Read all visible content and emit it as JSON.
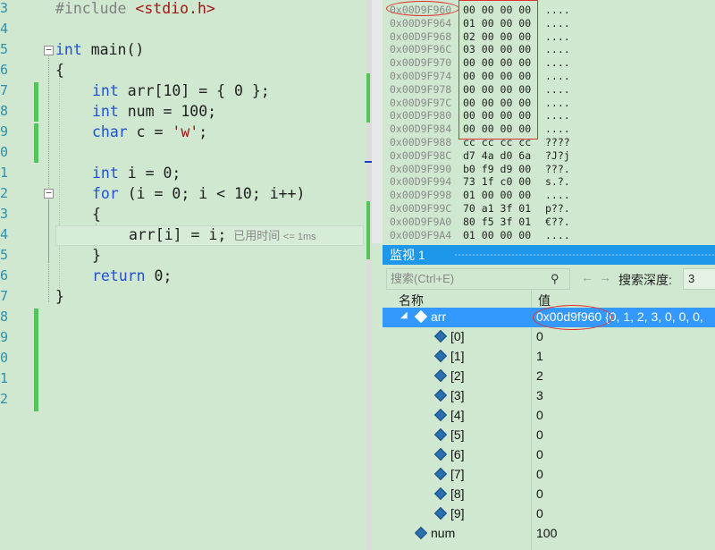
{
  "editor": {
    "line_numbers": [
      "3",
      "4",
      "5",
      "6",
      "7",
      "8",
      "9",
      "0",
      "1",
      "2",
      "3",
      "4",
      "5",
      "6",
      "7",
      "8",
      "9",
      "0",
      "1",
      "2"
    ],
    "include_kw": "#include",
    "include_hdr": "<stdio.h>",
    "main_sig_kw": "int",
    "main_sig": " main()",
    "open_brace": "{",
    "line_arr_kw": "int",
    "line_arr": " arr[10] = { 0 };",
    "line_num_kw": "int",
    "line_num": " num = 100;",
    "line_char_kw": "char",
    "line_char_a": " c = ",
    "line_char_str": "'w'",
    "line_char_b": ";",
    "line_i_kw": "int",
    "line_i": " i = 0;",
    "line_for_kw": "for",
    "line_for": " (i = 0; i < 10; i++)",
    "inner_open": "{",
    "line_assign": "arr[i] = i;",
    "perf_tip": "已用时间",
    "perf_time": "<= 1ms",
    "inner_close": "}",
    "line_return_kw": "return",
    "line_return": " 0;",
    "close_brace": "}"
  },
  "memory": {
    "rows": [
      {
        "addr": "0x00D9F960",
        "hex": "00 00 00 00",
        "ascii": "...."
      },
      {
        "addr": "0x00D9F964",
        "hex": "01 00 00 00",
        "ascii": "...."
      },
      {
        "addr": "0x00D9F968",
        "hex": "02 00 00 00",
        "ascii": "...."
      },
      {
        "addr": "0x00D9F96C",
        "hex": "03 00 00 00",
        "ascii": "...."
      },
      {
        "addr": "0x00D9F970",
        "hex": "00 00 00 00",
        "ascii": "...."
      },
      {
        "addr": "0x00D9F974",
        "hex": "00 00 00 00",
        "ascii": "...."
      },
      {
        "addr": "0x00D9F978",
        "hex": "00 00 00 00",
        "ascii": "...."
      },
      {
        "addr": "0x00D9F97C",
        "hex": "00 00 00 00",
        "ascii": "...."
      },
      {
        "addr": "0x00D9F980",
        "hex": "00 00 00 00",
        "ascii": "...."
      },
      {
        "addr": "0x00D9F984",
        "hex": "00 00 00 00",
        "ascii": "...."
      },
      {
        "addr": "0x00D9F988",
        "hex": "cc cc cc cc",
        "ascii": "????"
      },
      {
        "addr": "0x00D9F98C",
        "hex": "d7 4a d0 6a",
        "ascii": "?J?j"
      },
      {
        "addr": "0x00D9F990",
        "hex": "b0 f9 d9 00",
        "ascii": "???."
      },
      {
        "addr": "0x00D9F994",
        "hex": "73 1f c0 00",
        "ascii": "s.?."
      },
      {
        "addr": "0x00D9F998",
        "hex": "01 00 00 00",
        "ascii": "...."
      },
      {
        "addr": "0x00D9F99C",
        "hex": "70 a1 3f 01",
        "ascii": "p??."
      },
      {
        "addr": "0x00D9F9A0",
        "hex": "80 f5 3f 01",
        "ascii": "€??."
      },
      {
        "addr": "0x00D9F9A4",
        "hex": "01 00 00 00",
        "ascii": "...."
      }
    ]
  },
  "watch": {
    "title": "监视 1",
    "search_placeholder": "搜索(Ctrl+E)",
    "search_icon": "search-icon",
    "depth_label": "搜索深度:",
    "depth_value": "3",
    "col_name": "名称",
    "col_value": "值",
    "arr_name": "arr",
    "arr_addr": "0x00d9f960",
    "arr_rest": " {0, 1, 2, 3, 0, 0, 0,",
    "elements": [
      {
        "name": "[0]",
        "value": "0"
      },
      {
        "name": "[1]",
        "value": "1"
      },
      {
        "name": "[2]",
        "value": "2"
      },
      {
        "name": "[3]",
        "value": "3"
      },
      {
        "name": "[4]",
        "value": "0"
      },
      {
        "name": "[5]",
        "value": "0"
      },
      {
        "name": "[6]",
        "value": "0"
      },
      {
        "name": "[7]",
        "value": "0"
      },
      {
        "name": "[8]",
        "value": "0"
      },
      {
        "name": "[9]",
        "value": "0"
      }
    ],
    "num_name": "num",
    "num_value": "100"
  }
}
